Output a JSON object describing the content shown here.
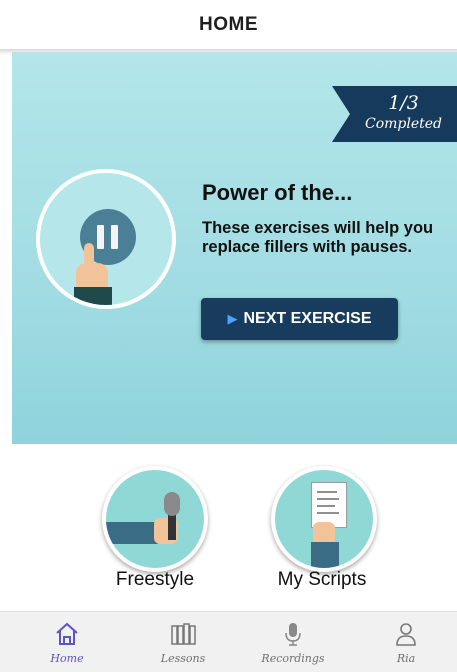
{
  "header": {
    "title": "HOME"
  },
  "progress": {
    "fraction": "1/3",
    "status": "Completed"
  },
  "exercise": {
    "title": "Power of the...",
    "description": "These exercises will help you replace fillers with pauses.",
    "next_label": "NEXT EXERCISE"
  },
  "shortcuts": {
    "freestyle_label": "Freestyle",
    "scripts_label": "My Scripts"
  },
  "tabs": [
    {
      "label": "Home",
      "icon": "home-icon",
      "active": true
    },
    {
      "label": "Lessons",
      "icon": "books-icon",
      "active": false
    },
    {
      "label": "Recordings",
      "icon": "microphone-icon",
      "active": false
    },
    {
      "label": "Ria",
      "icon": "person-icon",
      "active": false
    }
  ],
  "colors": {
    "accent": "#5b55c9",
    "dark_navy": "#173c5e",
    "hero_bg": "#a3dde3"
  }
}
